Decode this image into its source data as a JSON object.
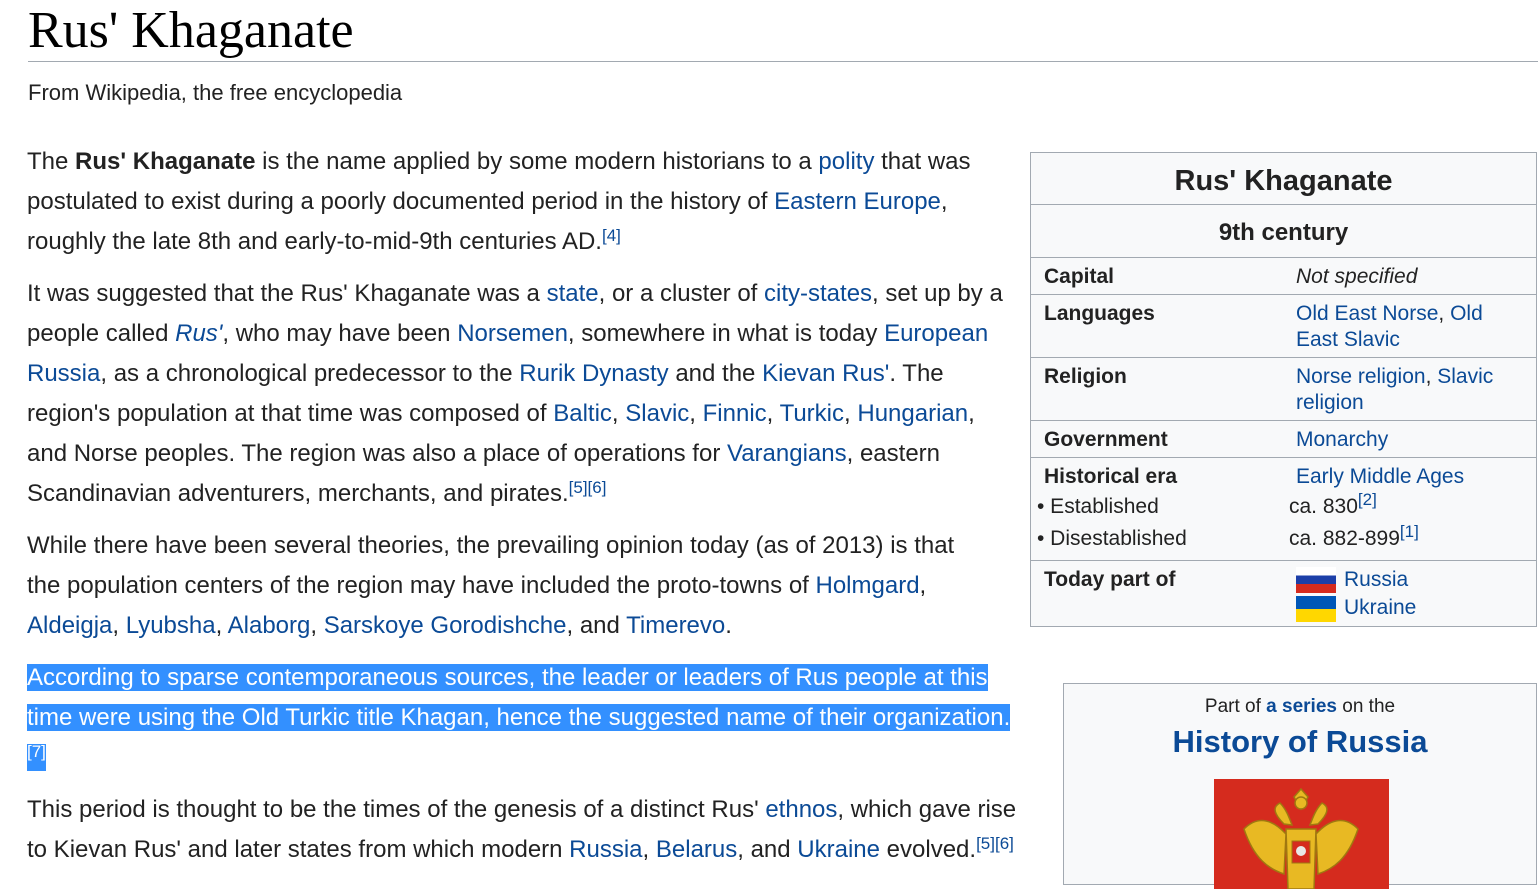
{
  "title": "Rus' Khaganate",
  "tagline": "From Wikipedia, the free encyclopedia",
  "p1": {
    "a": "The ",
    "bold": "Rus' Khaganate",
    "b": " is the name applied by some modern historians to a ",
    "l_polity": "polity",
    "c": " that was postulated to exist during a poorly documented period in the history of ",
    "l_eastern_europe": "Eastern Europe",
    "d": ", roughly the late 8th and early-to-mid-9th centuries AD.",
    "ref4": "[4]"
  },
  "p2": {
    "a": "It was suggested that the Rus' Khaganate was a ",
    "l_state": "state",
    "b": ", or a cluster of ",
    "l_city_states": "city-states",
    "c": ", set up by a people called ",
    "l_rus": "Rus'",
    "d": ", who may have been ",
    "l_norsemen": "Norsemen",
    "e": ", somewhere in what is today ",
    "l_european_russia": "European Russia",
    "f": ", as a chronological predecessor to the ",
    "l_rurik": "Rurik Dynasty",
    "g": " and the ",
    "l_kievan_rus": "Kievan Rus'",
    "h": ". The region's population at that time was composed of ",
    "l_baltic": "Baltic",
    "s1": ", ",
    "l_slavic": "Slavic",
    "s2": ", ",
    "l_finnic": "Finnic",
    "s3": ", ",
    "l_turkic": "Turkic",
    "s4": ", ",
    "l_hungarian": "Hungarian",
    "i": ", and Norse peoples. The region was also a place of operations for ",
    "l_varangians": "Varangians",
    "j": ", eastern Scandinavian adventurers, merchants, and pirates.",
    "ref5": "[5]",
    "ref6": "[6]"
  },
  "p3": {
    "a": "While there have been several theories, the prevailing opinion today (as of 2013) is that the population centers of the region may have included the proto-towns of ",
    "l_holmgard": "Holmgard",
    "s1": ", ",
    "l_aldeigja": "Aldeigja",
    "s2": ", ",
    "l_lyubsha": "Lyubsha",
    "s3": ", ",
    "l_alaborg": "Alaborg",
    "s4": ", ",
    "l_sarskoye": "Sarskoye Gorodishche",
    "b": ", and ",
    "l_timerevo": "Timerevo",
    "c": "."
  },
  "p4": {
    "text": "According to sparse contemporaneous sources, the leader or leaders of Rus people at this time were using the Old Turkic title Khagan, hence the suggested name of their organization.",
    "ref7": "[7]"
  },
  "p5": {
    "a": "This period is thought to be the times of the genesis of a distinct Rus' ",
    "l_ethnos": "ethnos",
    "b": ", which gave rise to Kievan Rus' and later states from which modern ",
    "l_russia": "Russia",
    "s1": ", ",
    "l_belarus": "Belarus",
    "c": ", and ",
    "l_ukraine": "Ukraine",
    "d": " evolved.",
    "ref5": "[5]",
    "ref6": "[6]"
  },
  "infobox": {
    "title": "Rus' Khaganate",
    "subtitle": "9th century",
    "capital_label": "Capital",
    "capital_value": "Not specified",
    "languages_label": "Languages",
    "lang_1": "Old East Norse",
    "lang_sep": ", ",
    "lang_2": "Old East Slavic",
    "religion_label": "Religion",
    "rel_1": "Norse religion",
    "rel_sep": ", ",
    "rel_2": "Slavic religion",
    "government_label": "Government",
    "government_value": "Monarchy",
    "era_label": "Historical era",
    "era_value": "Early Middle Ages",
    "established_label": "• Established",
    "established_value": "ca. 830",
    "established_ref": "[2]",
    "disestablished_label": "• Disestablished",
    "disestablished_value": "ca. 882-899",
    "disestablished_ref": "[1]",
    "today_label": "Today part of",
    "today_1": "Russia",
    "today_2": "Ukraine"
  },
  "series": {
    "pre": "Part of ",
    "link": "a series",
    "post": " on the",
    "title": "History of Russia"
  },
  "colors": {
    "link": "#0b4a96",
    "selection": "#3390ff",
    "infobox_bg": "#f8f9fa",
    "border": "#a2a9b1"
  }
}
